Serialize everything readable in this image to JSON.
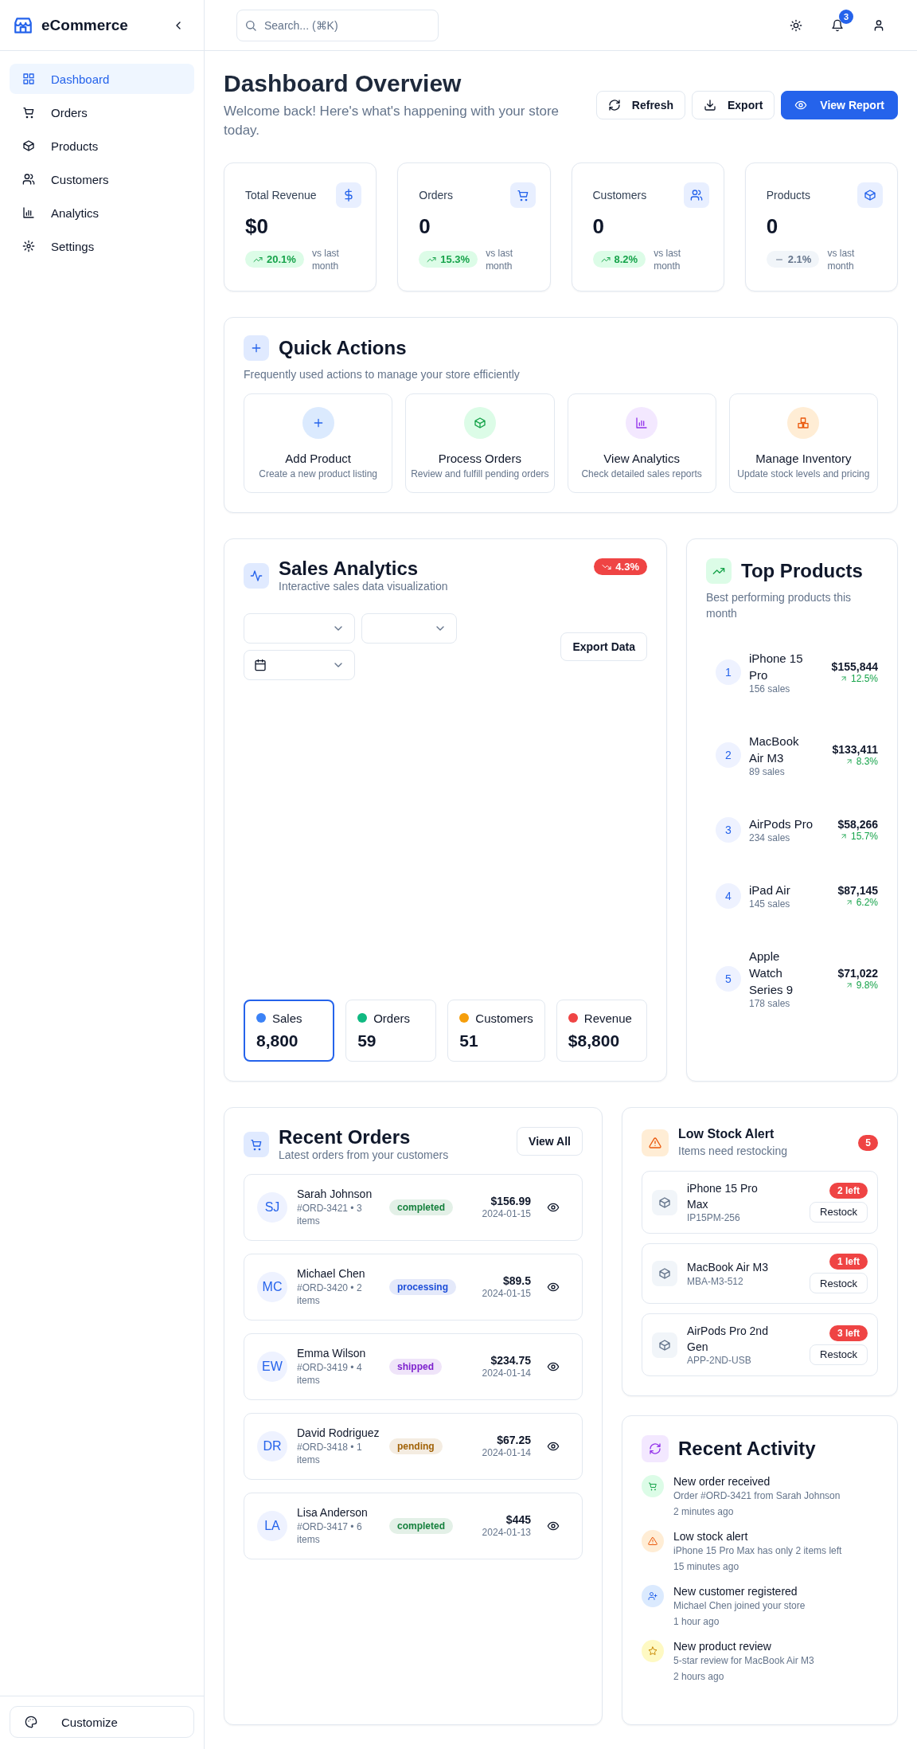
{
  "sidebar": {
    "brand": "eCommerce",
    "items": [
      {
        "label": "Dashboard",
        "selected": true
      },
      {
        "label": "Orders",
        "selected": false
      },
      {
        "label": "Products",
        "selected": false
      },
      {
        "label": "Customers",
        "selected": false
      },
      {
        "label": "Analytics",
        "selected": false
      },
      {
        "label": "Settings",
        "selected": false
      }
    ],
    "footer_button": "Customize"
  },
  "header": {
    "search": {
      "placeholder": "Search... (⌘K)"
    },
    "notification_count": "3"
  },
  "page": {
    "title": "Dashboard Overview",
    "subtitle": "Welcome back! Here's what's happening with your store today.",
    "buttons": [
      {
        "label": "Refresh",
        "kind": "outline"
      },
      {
        "label": "Export",
        "kind": "outline"
      },
      {
        "label": "View Report",
        "kind": "primary"
      }
    ]
  },
  "stats": [
    {
      "label": "Total Revenue",
      "value": "$0",
      "change": "20.1%",
      "kind": "up",
      "caption": "vs last month"
    },
    {
      "label": "Orders",
      "value": "0",
      "change": "15.3%",
      "kind": "up",
      "caption": "vs last month"
    },
    {
      "label": "Customers",
      "value": "0",
      "change": "8.2%",
      "kind": "up",
      "caption": "vs last month"
    },
    {
      "label": "Products",
      "value": "0",
      "change": "2.1%",
      "kind": "neutral",
      "caption": "vs last month"
    }
  ],
  "quick_actions": {
    "title": "Quick Actions",
    "subtitle": "Frequently used actions to manage your store efficiently",
    "actions": [
      {
        "title": "Add Product",
        "description": "Create a new product listing",
        "color": "#dbeafe"
      },
      {
        "title": "Process Orders",
        "description": "Review and fulfill pending orders",
        "color": "#dcfce7"
      },
      {
        "title": "View Analytics",
        "description": "Check detailed sales reports",
        "color": "#f3e8ff"
      },
      {
        "title": "Manage Inventory",
        "description": "Update stock levels and pricing",
        "color": "#ffedd5"
      }
    ]
  },
  "sales_analytics": {
    "title": "Sales Analytics",
    "subtitle": "Interactive sales data visualization",
    "change": "4.3%",
    "kind": "down",
    "dropdowns": [
      {
        "kind": "plain"
      },
      {
        "kind": "plain"
      },
      {
        "kind": "date"
      }
    ],
    "export_button": "Export Data",
    "metrics": [
      {
        "label": "Sales",
        "value": "8,800",
        "color": "#3b82f6",
        "selected": true
      },
      {
        "label": "Orders",
        "value": "59",
        "color": "#10b981",
        "selected": false
      },
      {
        "label": "Customers",
        "value": "51",
        "color": "#f59e0b",
        "selected": false
      },
      {
        "label": "Revenue",
        "value": "$8,800",
        "color": "#ef4444",
        "selected": false
      }
    ]
  },
  "top_products": {
    "title": "Top Products",
    "subtitle": "Best performing products this month",
    "products": [
      {
        "rank": "1",
        "name": "iPhone 15 Pro",
        "sales": "156 sales",
        "revenue": "$155,844",
        "growth": "12.5%"
      },
      {
        "rank": "2",
        "name": "MacBook Air M3",
        "sales": "89 sales",
        "revenue": "$133,411",
        "growth": "8.3%"
      },
      {
        "rank": "3",
        "name": "AirPods Pro",
        "sales": "234 sales",
        "revenue": "$58,266",
        "growth": "15.7%"
      },
      {
        "rank": "4",
        "name": "iPad Air",
        "sales": "145 sales",
        "revenue": "$87,145",
        "growth": "6.2%"
      },
      {
        "rank": "5",
        "name": "Apple Watch Series 9",
        "sales": "178 sales",
        "revenue": "$71,022",
        "growth": "9.8%"
      }
    ]
  },
  "recent_orders": {
    "title": "Recent Orders",
    "subtitle": "Latest orders from your customers",
    "view_all": "View All",
    "orders": [
      {
        "initials": "SJ",
        "name": "Sarah Johnson",
        "meta": "#ORD-3421 • 3 items",
        "status": "completed",
        "color": "#15803d",
        "amount": "$156.99",
        "date": "2024-01-15"
      },
      {
        "initials": "MC",
        "name": "Michael Chen",
        "meta": "#ORD-3420 • 2 items",
        "status": "processing",
        "color": "#1d4ed8",
        "amount": "$89.5",
        "date": "2024-01-15"
      },
      {
        "initials": "EW",
        "name": "Emma Wilson",
        "meta": "#ORD-3419 • 4 items",
        "status": "shipped",
        "color": "#7e22ce",
        "amount": "$234.75",
        "date": "2024-01-14"
      },
      {
        "initials": "DR",
        "name": "David Rodriguez",
        "meta": "#ORD-3418 • 1 items",
        "status": "pending",
        "color": "#a16207",
        "amount": "$67.25",
        "date": "2024-01-14"
      },
      {
        "initials": "LA",
        "name": "Lisa Anderson",
        "meta": "#ORD-3417 • 6 items",
        "status": "completed",
        "color": "#15803d",
        "amount": "$445",
        "date": "2024-01-13"
      }
    ]
  },
  "low_stock": {
    "title": "Low Stock Alert",
    "subtitle": "Items need restocking",
    "count": "5",
    "items": [
      {
        "name": "iPhone 15 Pro Max",
        "sku": "IP15PM-256",
        "left": "2 left",
        "button": "Restock"
      },
      {
        "name": "MacBook Air M3",
        "sku": "MBA-M3-512",
        "left": "1 left",
        "button": "Restock"
      },
      {
        "name": "AirPods Pro 2nd Gen",
        "sku": "APP-2ND-USB",
        "left": "3 left",
        "button": "Restock"
      }
    ]
  },
  "recent_activity": {
    "title": "Recent Activity",
    "items": [
      {
        "title": "New order received",
        "description": "Order #ORD-3421 from Sarah Johnson",
        "time": "2 minutes ago",
        "color": "#dcfce7"
      },
      {
        "title": "Low stock alert",
        "description": "iPhone 15 Pro Max has only 2 items left",
        "time": "15 minutes ago",
        "color": "#ffedd5"
      },
      {
        "title": "New customer registered",
        "description": "Michael Chen joined your store",
        "time": "1 hour ago",
        "color": "#dbeafe"
      },
      {
        "title": "New product review",
        "description": "5-star review for MacBook Air M3",
        "time": "2 hours ago",
        "color": "#fef9c3"
      }
    ]
  }
}
